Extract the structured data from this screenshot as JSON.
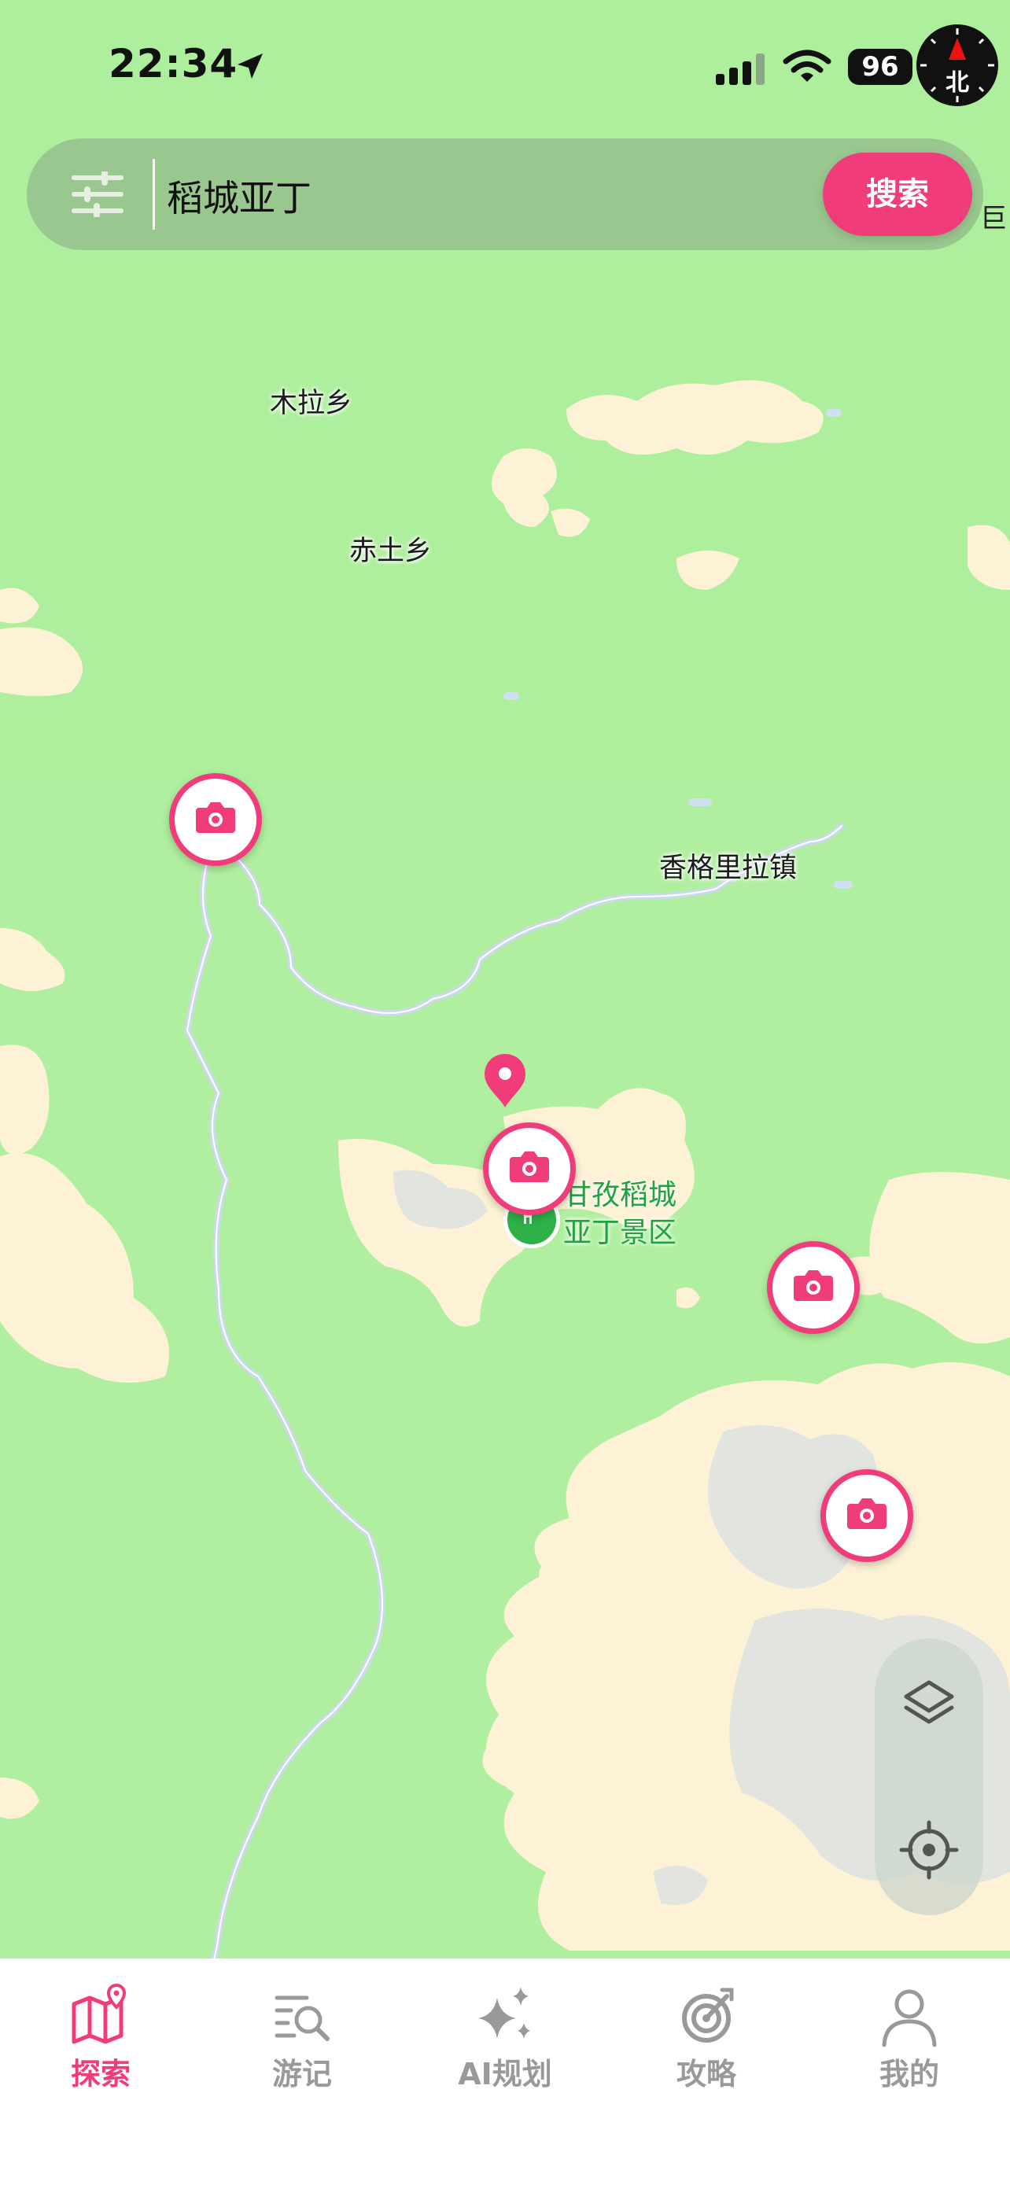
{
  "status_bar": {
    "time": "22:34",
    "battery": "96",
    "compass_label": "北"
  },
  "search": {
    "value": "稻城亚丁",
    "button_label": "搜索",
    "edge_label": "巨"
  },
  "map": {
    "labels": [
      "木拉乡",
      "赤土乡",
      "香格里拉镇"
    ],
    "scenic_area": {
      "line1": "甘孜稻城",
      "line2": "亚丁景区"
    }
  },
  "tabs": [
    {
      "label": "探索",
      "icon": "map-icon",
      "active": true
    },
    {
      "label": "游记",
      "icon": "search-list-icon",
      "active": false
    },
    {
      "label": "AI规划",
      "icon": "sparkle-icon",
      "active": false
    },
    {
      "label": "攻略",
      "icon": "target-icon",
      "active": false
    },
    {
      "label": "我的",
      "icon": "user-icon",
      "active": false
    }
  ],
  "colors": {
    "accent": "#f13c7b",
    "map_green": "#aeef9d",
    "scenic_green": "#2db148"
  }
}
